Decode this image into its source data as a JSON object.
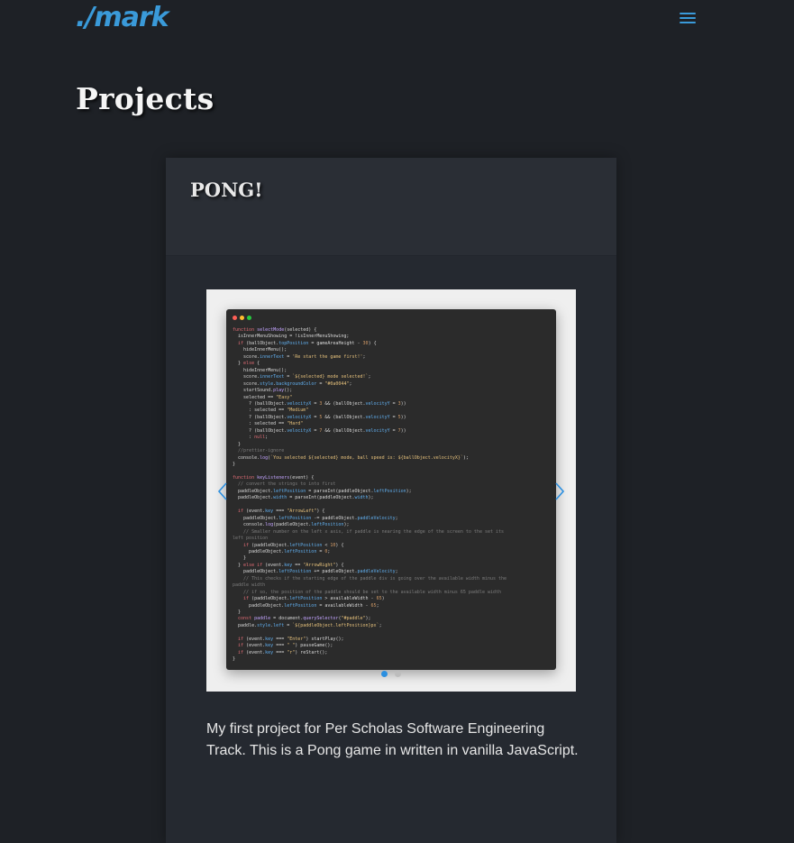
{
  "nav": {
    "logo": "./mark",
    "menu_icon": "hamburger-menu-icon",
    "accent_color": "#3a9ad9"
  },
  "page": {
    "title": "Projects"
  },
  "projects": [
    {
      "title": "PONG!",
      "description": "My first project for Per Scholas Software Engineering Track. This is a Pong game in written in vanilla JavaScript.",
      "carousel": {
        "active_index": 0,
        "slide_count": 2,
        "prev_icon": "chevron-left-icon",
        "next_icon": "chevron-right-icon",
        "active_color": "#2b8fe0"
      }
    }
  ]
}
